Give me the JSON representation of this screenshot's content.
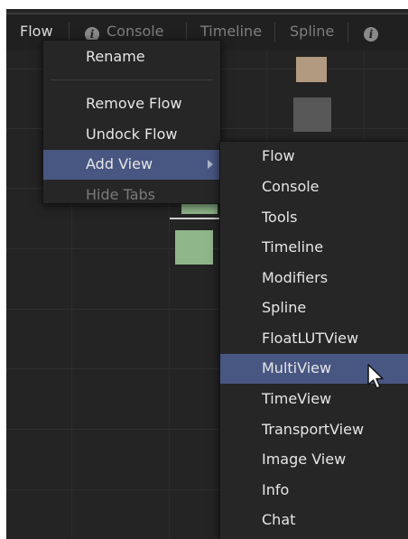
{
  "tabs": [
    {
      "label": "Flow",
      "active": true
    },
    {
      "label": "Console",
      "icon": "info-icon"
    },
    {
      "label": "Timeline"
    },
    {
      "label": "Spline"
    },
    {
      "icon": "info-icon"
    }
  ],
  "context_menu": {
    "items": [
      "Rename",
      "Remove Flow",
      "Undock Flow",
      "Add View",
      "Hide Tabs"
    ],
    "highlighted": "Add View",
    "disabled": [
      "Hide Tabs"
    ]
  },
  "add_view_submenu": {
    "items": [
      "Flow",
      "Console",
      "Tools",
      "Timeline",
      "Modifiers",
      "Spline",
      "FloatLUTView",
      "MultiView",
      "TimeView",
      "TransportView",
      "Image View",
      "Info",
      "Chat"
    ],
    "highlighted": "MultiView"
  },
  "colors": {
    "highlight": "#485682",
    "node_tan": "#b19a80",
    "node_gray": "#575757",
    "node_green": "#8fb58a"
  },
  "icons": [
    "info-icon",
    "submenu-arrow-icon",
    "mouse-pointer-icon"
  ]
}
